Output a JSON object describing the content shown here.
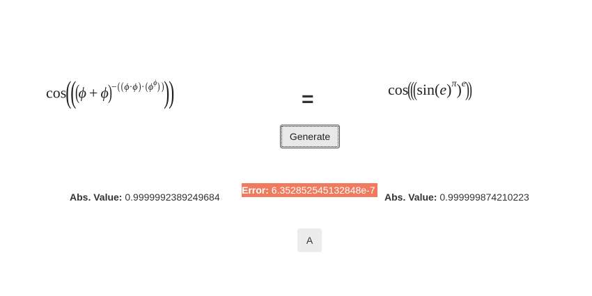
{
  "left_expression": {
    "cos": "cos",
    "phi": "ϕ",
    "plus": "+",
    "minus": "−",
    "dot": "·"
  },
  "right_expression": {
    "cos": "cos",
    "sin": "sin",
    "e": "e",
    "pi": "π"
  },
  "equals": "=",
  "generate_button": "Generate",
  "left_abs": {
    "label": "Abs. Value:",
    "value": "0.9999992389249684"
  },
  "error": {
    "label": "Error:",
    "value": "6.352852545132848e-7"
  },
  "right_abs": {
    "label": "Abs. Value:",
    "value": "0.999999874210223"
  },
  "a_button": "A",
  "colors": {
    "error_bg": "#f07a5e",
    "button_bg": "#e8e8e8"
  }
}
